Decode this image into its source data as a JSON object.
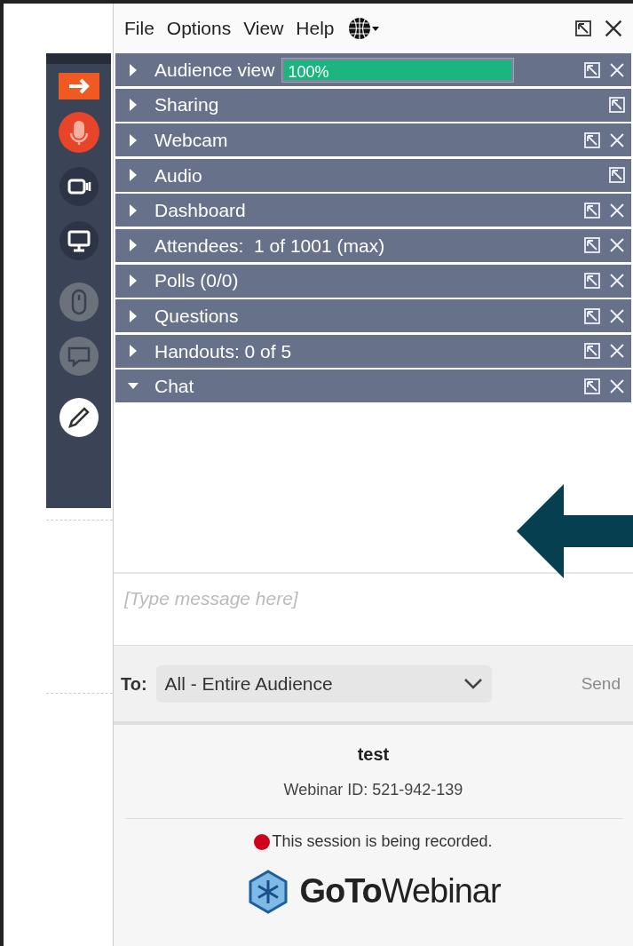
{
  "menu": [
    {
      "label": "File"
    },
    {
      "label": "Options"
    },
    {
      "label": "View"
    },
    {
      "label": "Help"
    }
  ],
  "panels": [
    {
      "label": "Audience view",
      "expanded": false,
      "popout": true,
      "closable": true,
      "meter": {
        "level": 1,
        "reading": "100%"
      }
    },
    {
      "label": "Sharing",
      "expanded": false,
      "popout": true,
      "closable": false
    },
    {
      "label": "Webcam",
      "expanded": false,
      "popout": true,
      "closable": true
    },
    {
      "label": "Audio",
      "expanded": false,
      "popout": true,
      "closable": false
    },
    {
      "label": "Dashboard",
      "expanded": false,
      "popout": true,
      "closable": true
    },
    {
      "label": "Attendees:  1 of 1001 (max)",
      "expanded": false,
      "popout": true,
      "closable": true
    },
    {
      "label": "Polls (0/0)",
      "expanded": false,
      "popout": true,
      "closable": true
    },
    {
      "label": "Questions",
      "expanded": false,
      "popout": true,
      "closable": true
    },
    {
      "label": "Handouts: 0 of 5",
      "expanded": false,
      "popout": true,
      "closable": true
    },
    {
      "label": "Chat",
      "expanded": true,
      "popout": true,
      "closable": true
    }
  ],
  "chat": {
    "placeholder": "[Type message here]",
    "to_label": "To:",
    "to_value": "All - Entire Audience",
    "send": {
      "label": "Send",
      "disabled": true
    }
  },
  "footer": {
    "title": "test",
    "webinar_id": "Webinar ID: 521-942-139",
    "recording": {
      "text": "This session is being recorded.",
      "on": true
    },
    "logo": "**GoTo**Webinar"
  }
}
